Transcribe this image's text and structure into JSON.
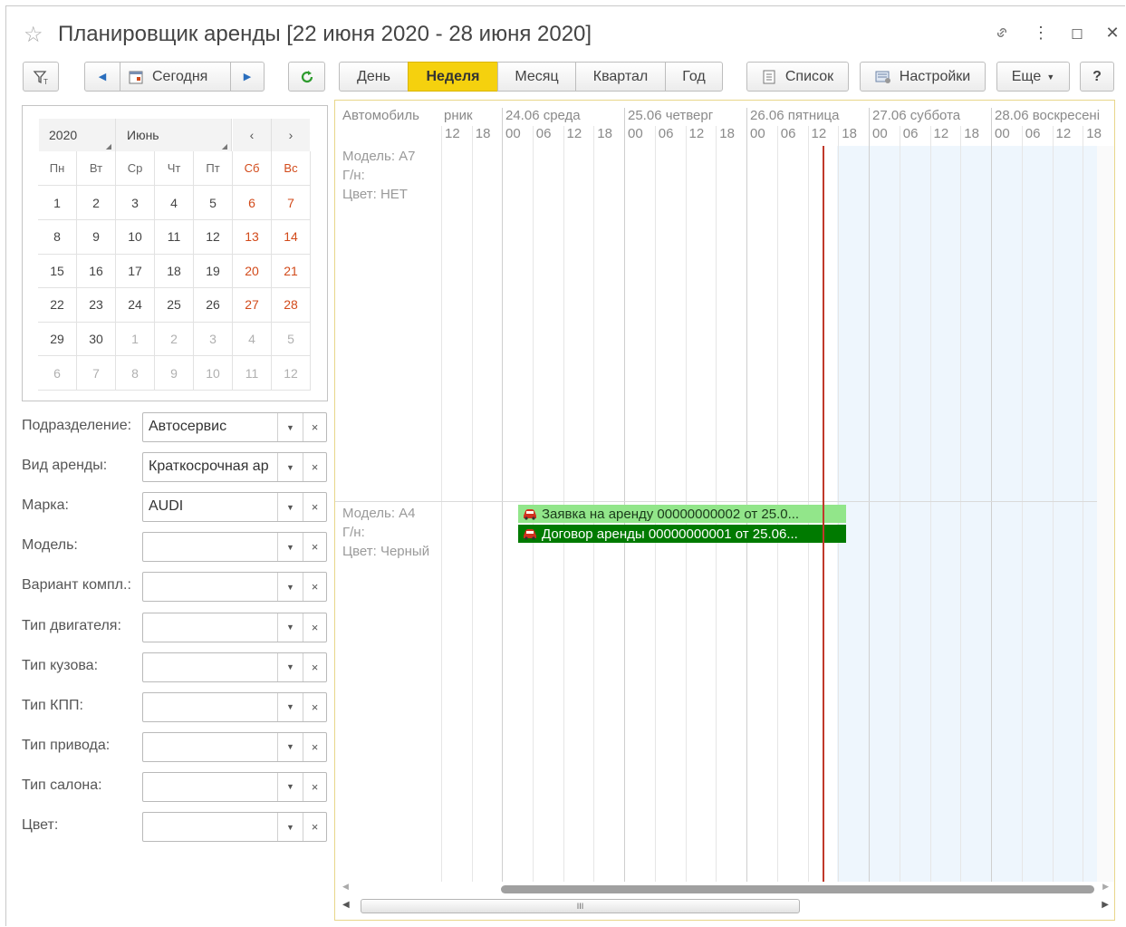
{
  "window": {
    "title": "Планировщик аренды [22 июня 2020 - 28 июня 2020]"
  },
  "toolbar": {
    "today_label": "Сегодня",
    "period_tabs": [
      "День",
      "Неделя",
      "Месяц",
      "Квартал",
      "Год"
    ],
    "active_tab": "Неделя",
    "list_label": "Список",
    "settings_label": "Настройки",
    "more_label": "Еще",
    "help_label": "?"
  },
  "calendar": {
    "year": "2020",
    "month": "Июнь",
    "weekdays": [
      "Пн",
      "Вт",
      "Ср",
      "Чт",
      "Пт",
      "Сб",
      "Вс"
    ],
    "weeks": [
      [
        "1",
        "2",
        "3",
        "4",
        "5",
        "6",
        "7"
      ],
      [
        "8",
        "9",
        "10",
        "11",
        "12",
        "13",
        "14"
      ],
      [
        "15",
        "16",
        "17",
        "18",
        "19",
        "20",
        "21"
      ],
      [
        "22",
        "23",
        "24",
        "25",
        "26",
        "27",
        "28"
      ],
      [
        "29",
        "30",
        "1",
        "2",
        "3",
        "4",
        "5"
      ],
      [
        "6",
        "7",
        "8",
        "9",
        "10",
        "11",
        "12"
      ]
    ]
  },
  "filters": [
    {
      "label": "Подразделение:",
      "value": "Автосервис"
    },
    {
      "label": "Вид аренды:",
      "value": "Краткосрочная ар"
    },
    {
      "label": "Марка:",
      "value": "AUDI"
    },
    {
      "label": "Модель:",
      "value": ""
    },
    {
      "label": "Вариант компл.:",
      "value": ""
    },
    {
      "label": "Тип двигателя:",
      "value": ""
    },
    {
      "label": "Тип кузова:",
      "value": ""
    },
    {
      "label": "Тип КПП:",
      "value": ""
    },
    {
      "label": "Тип привода:",
      "value": ""
    },
    {
      "label": "Тип салона:",
      "value": ""
    },
    {
      "label": "Цвет:",
      "value": ""
    }
  ],
  "planner": {
    "resource_header": "Автомобиль",
    "days": [
      "рник",
      "24.06 среда",
      "25.06 четверг",
      "26.06 пятница",
      "27.06 суббота",
      "28.06 воскресені"
    ],
    "hours_first": [
      "12",
      "18"
    ],
    "hours": [
      "00",
      "06",
      "12",
      "18"
    ],
    "resources": [
      {
        "model": "Модель: А7",
        "plate": "Г/н:",
        "color": "Цвет: НЕТ"
      },
      {
        "model": "Модель: А4",
        "plate": "Г/н:",
        "color": "Цвет: Черный"
      }
    ],
    "bookings": [
      {
        "text": "Заявка на аренду 00000000002 от 25.0...",
        "bg": "#92e68a",
        "fg": "#1a3a1a"
      },
      {
        "text": "Договор аренды 00000000001 от 25.06...",
        "bg": "#007a00",
        "fg": "#ffffff"
      }
    ],
    "scroll_thumb_label": "III"
  },
  "colors": {
    "accent": "#f5d10e",
    "weekend": "#d24a1a",
    "now_line": "#c0392b",
    "weekend_shade": "#eef6fd"
  }
}
